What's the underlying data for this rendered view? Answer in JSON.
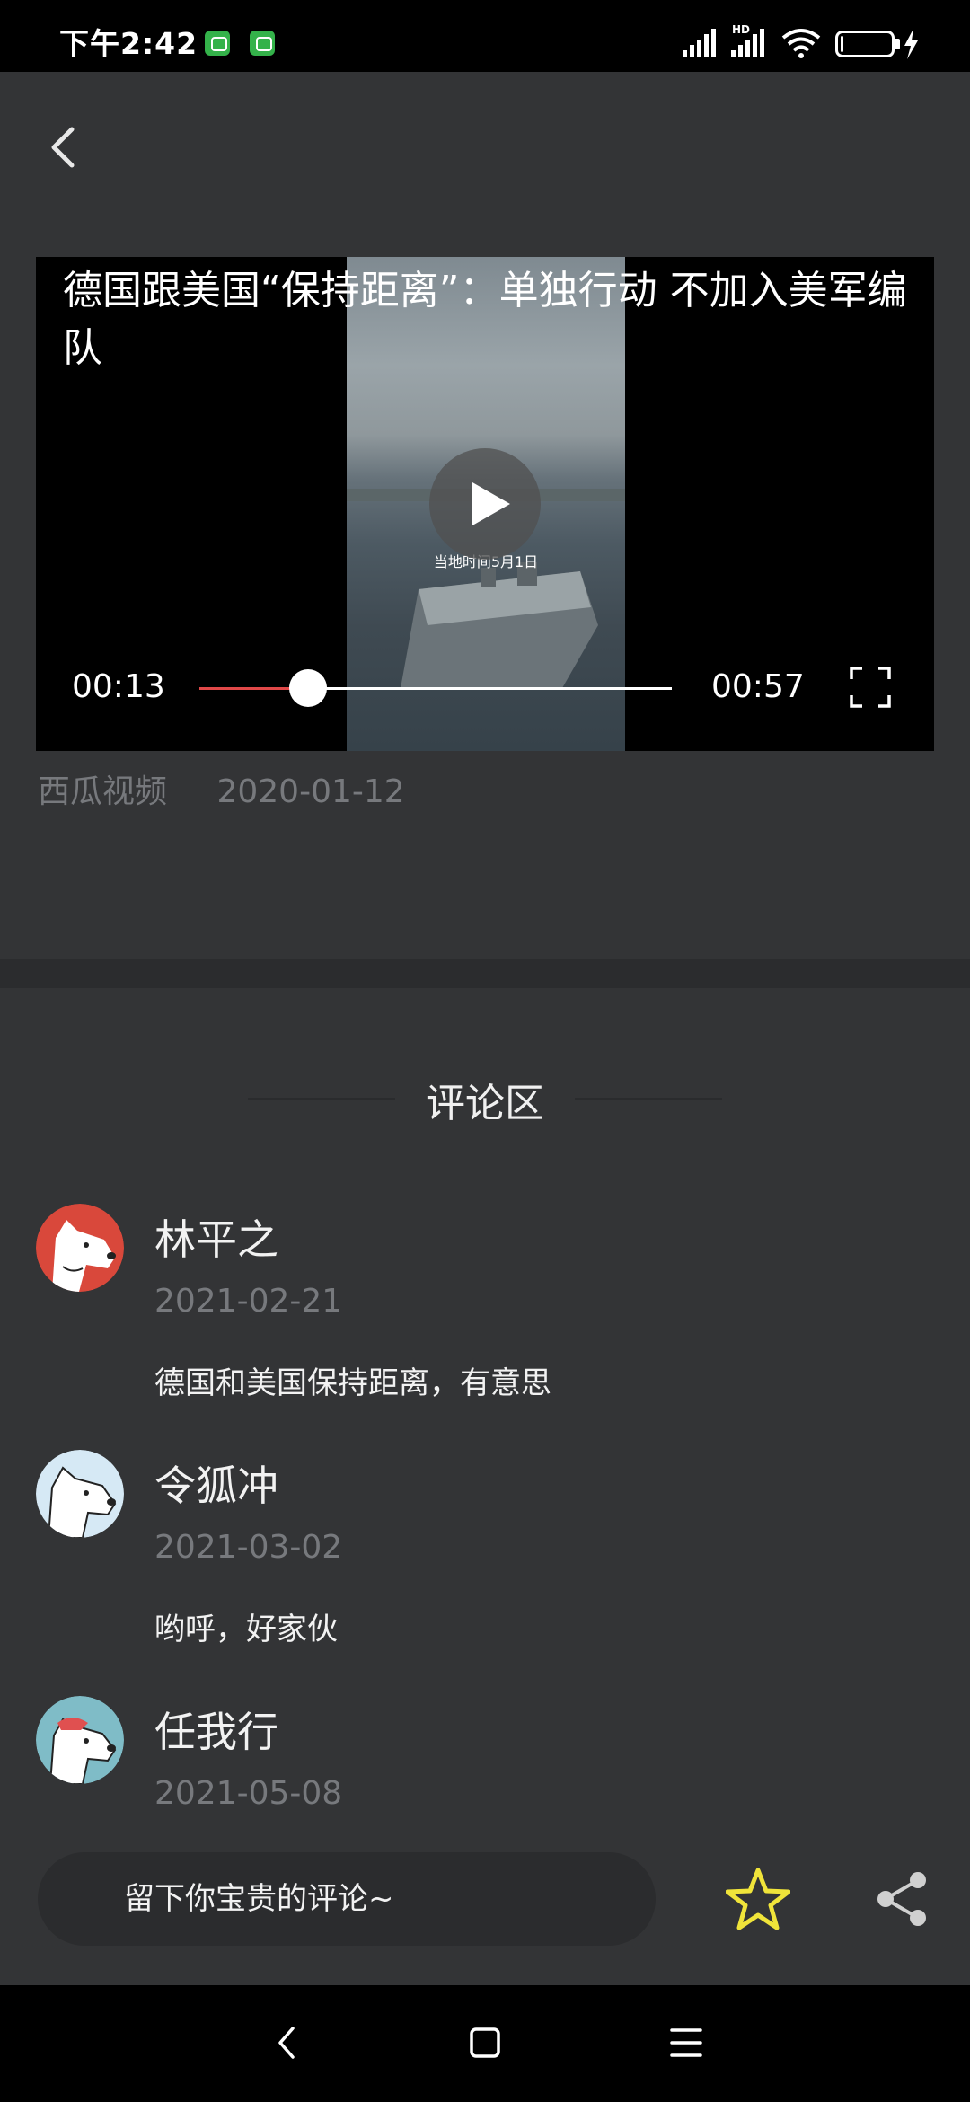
{
  "status_bar": {
    "time": "下午2:42",
    "hd_label": "HD",
    "battery_level": "6",
    "battery_fraction": 0.06
  },
  "header": {
    "back_icon": "chevron-left-icon"
  },
  "video": {
    "title": "德国跟美国“保持距离”：单独行动 不加入美军编队",
    "frame_caption": "当地时间5月1日",
    "current_time": "00:13",
    "duration": "00:57",
    "progress_fraction": 0.23,
    "play_icon": "play-icon",
    "fullscreen_icon": "fullscreen-icon",
    "progress_color": "#e04848"
  },
  "meta": {
    "source": "西瓜视频",
    "date": "2020-01-12"
  },
  "comments_section": {
    "title": "评论区",
    "comments": [
      {
        "name": "林平之",
        "date": "2021-02-21",
        "text": "德国和美国保持距离，有意思",
        "avatar_color": "#d9483b"
      },
      {
        "name": "令狐冲",
        "date": "2021-03-02",
        "text": "哟呼，好家伙",
        "avatar_color": "#d6e9f5"
      },
      {
        "name": "任我行",
        "date": "2021-05-08",
        "text": "",
        "avatar_color": "#7fbcc7"
      }
    ]
  },
  "bottom_bar": {
    "input_placeholder": "留下你宝贵的评论~",
    "favorite_icon": "star-icon",
    "favorite_color": "#f0e43a",
    "share_icon": "share-icon"
  },
  "nav_bar": {
    "back_icon": "nav-back-icon",
    "home_icon": "nav-home-icon",
    "menu_icon": "nav-menu-icon"
  }
}
